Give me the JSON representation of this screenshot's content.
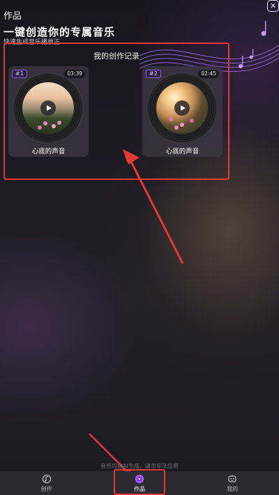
{
  "header": {
    "page_title": "作品",
    "hero_title": "一键创造你的专属音乐",
    "hero_subtitle": "快速生成音乐播放正",
    "close_glyph": "✕"
  },
  "records": {
    "heading": "我的创作记录",
    "items": [
      {
        "badge": "#1",
        "duration": "03:39",
        "title": "心底的声音",
        "art": "pink-flowers"
      },
      {
        "badge": "#2",
        "duration": "02:45",
        "title": "心底的声音",
        "art": "sunset-flowers"
      }
    ]
  },
  "footer": {
    "note": "音乐均由AI生成，请勿非法应用"
  },
  "nav": {
    "items": [
      {
        "label": "创作",
        "icon": "music-note-icon",
        "active": false
      },
      {
        "label": "作品",
        "icon": "disc-icon",
        "active": true
      },
      {
        "label": "我的",
        "icon": "robot-icon",
        "active": false
      }
    ]
  },
  "colors": {
    "accent": "#8e5cff",
    "annotation": "#e53935",
    "nav_bg": "#2b2a33"
  }
}
